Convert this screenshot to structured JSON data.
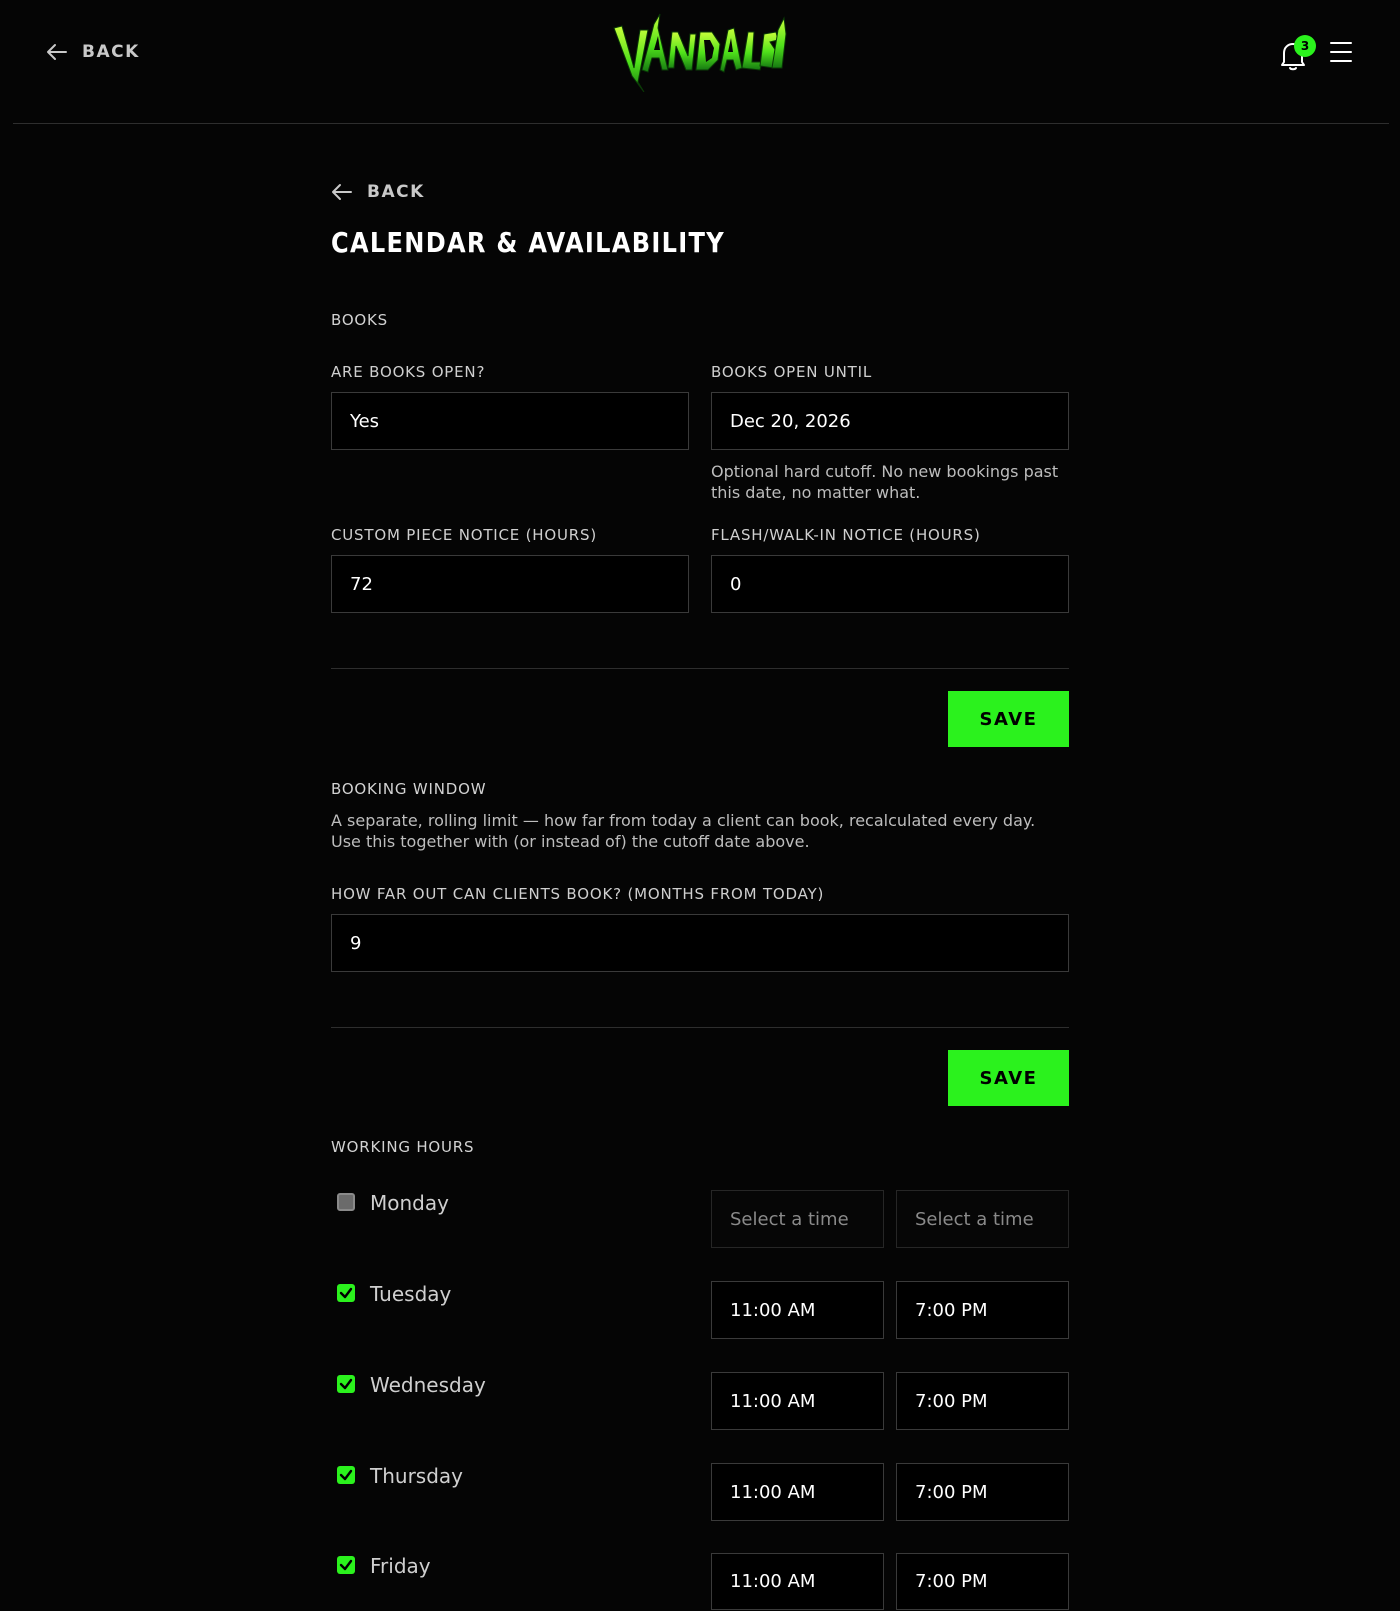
{
  "header": {
    "back_label": "BACK",
    "notification_count": "3",
    "logo_text": "VANDALSYN"
  },
  "page": {
    "back_label": "BACK",
    "title": "CALENDAR & AVAILABILITY"
  },
  "books": {
    "section_label": "BOOKS",
    "open_label": "ARE BOOKS OPEN?",
    "open_value": "Yes",
    "until_label": "BOOKS OPEN UNTIL",
    "until_value": "Dec 20, 2026",
    "until_help": "Optional hard cutoff. No new bookings past this date, no matter what.",
    "custom_notice_label": "CUSTOM PIECE NOTICE (HOURS)",
    "custom_notice_value": "72",
    "flash_notice_label": "FLASH/WALK-IN NOTICE (HOURS)",
    "flash_notice_value": "0",
    "save_label": "SAVE"
  },
  "booking_window": {
    "section_label": "BOOKING WINDOW",
    "description": "A separate, rolling limit — how far from today a client can book, recalculated every day. Use this together with (or instead of) the cutoff date above.",
    "months_label": "HOW FAR OUT CAN CLIENTS BOOK? (MONTHS FROM TODAY)",
    "months_value": "9",
    "save_label": "SAVE"
  },
  "working_hours": {
    "section_label": "WORKING HOURS",
    "placeholder": "Select a time",
    "days": [
      {
        "name": "Monday",
        "enabled": false,
        "start": "",
        "end": ""
      },
      {
        "name": "Tuesday",
        "enabled": true,
        "start": "11:00 AM",
        "end": "7:00 PM"
      },
      {
        "name": "Wednesday",
        "enabled": true,
        "start": "11:00 AM",
        "end": "7:00 PM"
      },
      {
        "name": "Thursday",
        "enabled": true,
        "start": "11:00 AM",
        "end": "7:00 PM"
      },
      {
        "name": "Friday",
        "enabled": true,
        "start": "11:00 AM",
        "end": "7:00 PM"
      }
    ]
  },
  "colors": {
    "accent": "#2bf21d",
    "background": "#050505",
    "border": "#3a3a3a"
  }
}
